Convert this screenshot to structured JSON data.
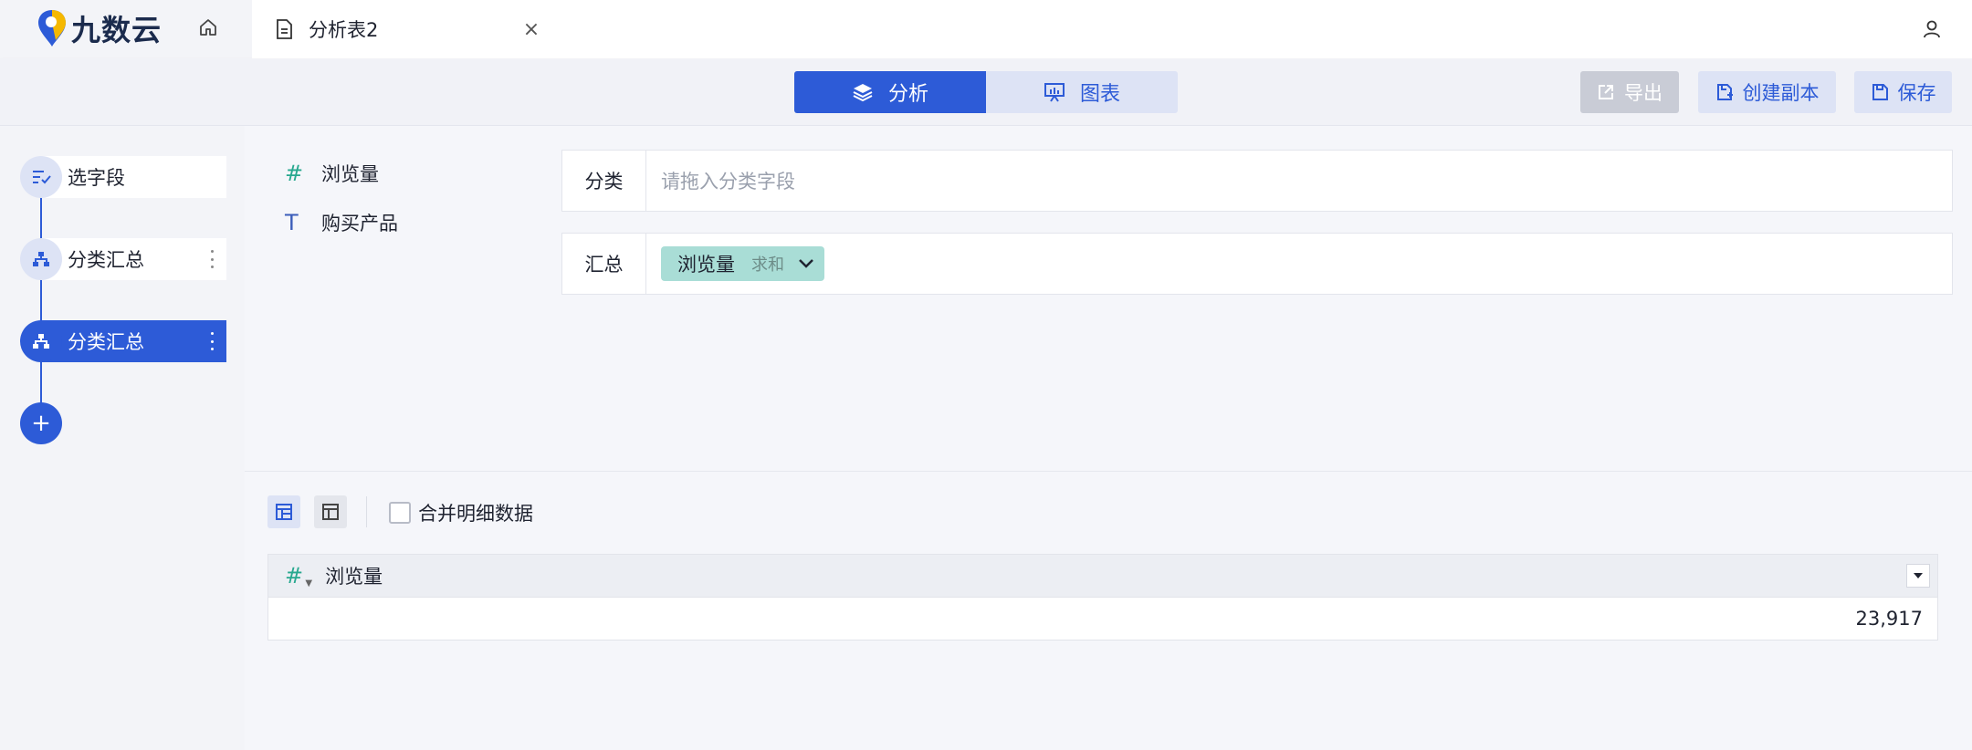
{
  "app": {
    "brand": "九数云"
  },
  "tab": {
    "title": "分析表2"
  },
  "modes": {
    "analysis": "分析",
    "chart": "图表"
  },
  "actions": {
    "export": "导出",
    "copy": "创建副本",
    "save": "保存"
  },
  "steps": [
    {
      "label": "选字段",
      "icon": "select-fields-icon"
    },
    {
      "label": "分类汇总",
      "icon": "group-summary-icon"
    },
    {
      "label": "分类汇总",
      "icon": "group-summary-icon",
      "active": true
    }
  ],
  "add_step": "+",
  "fields": [
    {
      "type_symbol": "#",
      "name": "浏览量"
    },
    {
      "type_symbol": "T",
      "name": "购买产品"
    }
  ],
  "config": {
    "category_label": "分类",
    "category_placeholder": "请拖入分类字段",
    "summary_label": "汇总",
    "summary_chip": {
      "field": "浏览量",
      "aggregation": "求和"
    }
  },
  "result": {
    "merge_label": "合并明细数据",
    "merge_checked": false,
    "columns": [
      {
        "type_symbol": "#",
        "name": "浏览量"
      }
    ],
    "rows": [
      [
        "23,917"
      ]
    ]
  },
  "colors": {
    "accent": "#2d5bd7",
    "chip": "#a9ddd6",
    "numeric": "#27a88f"
  }
}
